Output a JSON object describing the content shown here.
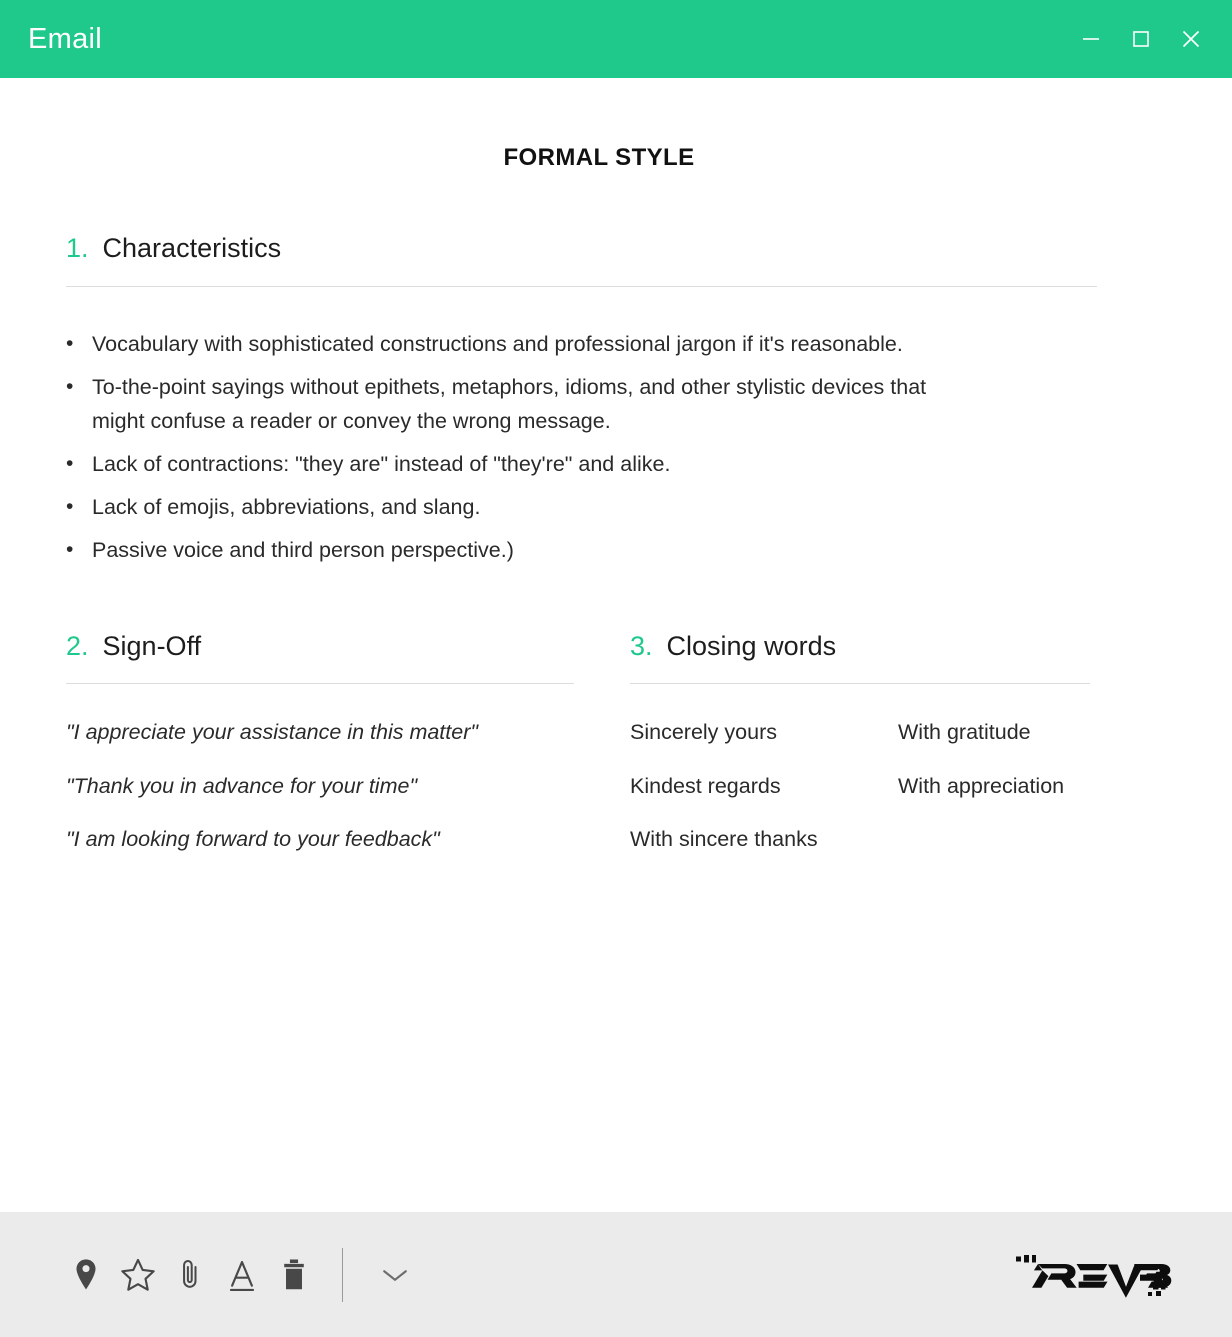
{
  "window": {
    "title": "Email",
    "accent_color": "#1fc98c",
    "controls": [
      {
        "name": "minimize",
        "glyph": "minimize-icon"
      },
      {
        "name": "maximize",
        "glyph": "maximize-icon"
      },
      {
        "name": "close",
        "glyph": "close-icon"
      }
    ]
  },
  "document": {
    "title": "FORMAL STYLE",
    "sections": [
      {
        "number": "1.",
        "heading": "Characteristics",
        "bullet_marker": "•",
        "items": [
          "Vocabulary with sophisticated constructions and professional jargon if it's reasonable.",
          "To-the-point sayings without epithets, metaphors, idioms, and other stylistic devices that might confuse a reader or convey the wrong message.",
          "Lack of contractions: \"they are\" instead of \"they're\" and alike.",
          "Lack of emojis, abbreviations, and slang.",
          "Passive voice and third person perspective.)"
        ]
      },
      {
        "number": "2.",
        "heading": "Sign-Off",
        "items": [
          "\"I appreciate your assistance in this matter\"",
          "\"Thank you in advance for your time\"",
          "\"I am looking forward to your feedback\""
        ]
      },
      {
        "number": "3.",
        "heading": "Closing words",
        "column_one": [
          "Sincerely yours",
          "Kindest regards",
          "With sincere thanks"
        ],
        "column_two": [
          "With gratitude",
          "With appreciation"
        ]
      }
    ]
  },
  "footer": {
    "background_color": "#ebebeb",
    "tools": [
      {
        "name": "location-pin-icon",
        "label": "Location"
      },
      {
        "name": "star-icon",
        "label": "Star"
      },
      {
        "name": "paperclip-icon",
        "label": "Attach"
      },
      {
        "name": "text-format-icon",
        "label": "Formatting"
      },
      {
        "name": "trash-icon",
        "label": "Delete"
      }
    ],
    "more_options": {
      "name": "chevron-down-icon",
      "label": "More"
    },
    "logo": {
      "name": "reverb-logo",
      "text": "REVERB"
    }
  }
}
